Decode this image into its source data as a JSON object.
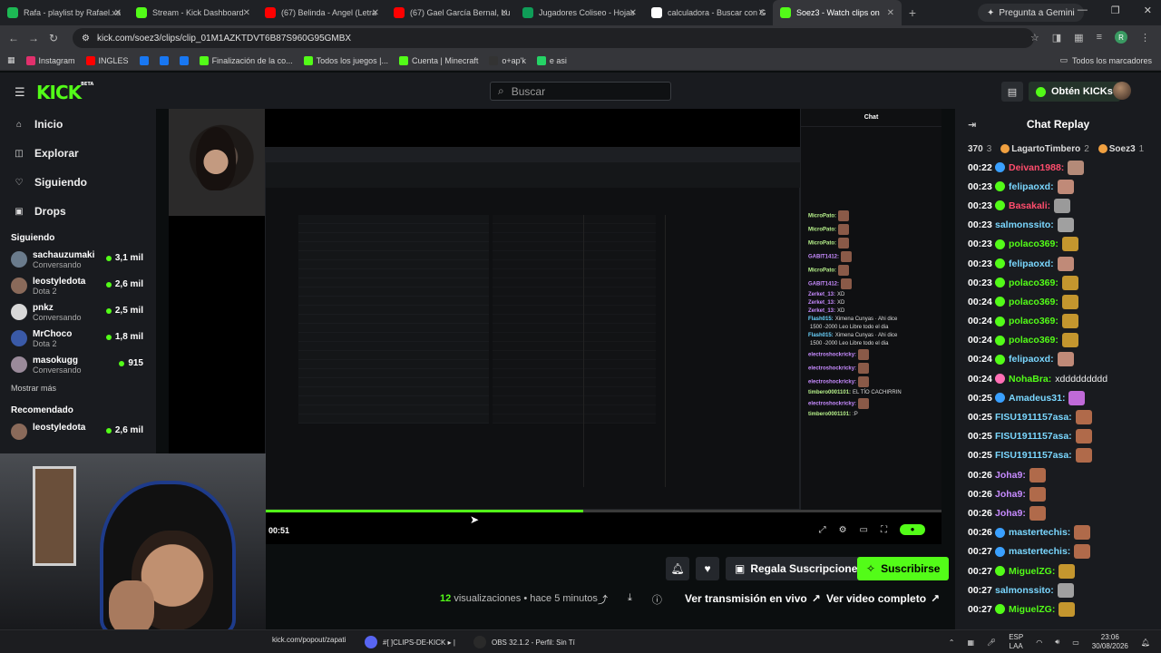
{
  "browser": {
    "tabs": [
      {
        "title": "Rafa - playlist by Rafael.xa",
        "color": "#1db954",
        "active": false
      },
      {
        "title": "Stream - Kick Dashboard",
        "color": "#53fc18",
        "active": false
      },
      {
        "title": "(67) Belinda - Angel (Letra",
        "color": "#ff0000",
        "active": false
      },
      {
        "title": "(67) Gael García Bernal, Lu",
        "color": "#ff0000",
        "active": false
      },
      {
        "title": "Jugadores Coliseo - Hojas",
        "color": "#0f9d58",
        "active": false
      },
      {
        "title": "calculadora - Buscar con G",
        "color": "#ffffff",
        "active": false
      },
      {
        "title": "Soez3 - Watch clips on",
        "color": "#53fc18",
        "active": true
      }
    ],
    "new_tab": "+",
    "gemini_label": "Pregunta a Gemini",
    "url": "kick.com/soez3/clips/clip_01M1AZKTDVT6B87S960G95GMBX",
    "bookmarks": [
      {
        "label": "Instagram",
        "color": "#e1306c"
      },
      {
        "label": "INGLES",
        "color": "#ff0000"
      },
      {
        "label": "",
        "color": "#1877f2"
      },
      {
        "label": "",
        "color": "#1877f2"
      },
      {
        "label": "",
        "color": "#1877f2"
      },
      {
        "label": "Finalización de la co...",
        "color": "#53fc18"
      },
      {
        "label": "Todos los juegos |...",
        "color": "#53fc18"
      },
      {
        "label": "Cuenta | Minecraft",
        "color": "#53fc18"
      },
      {
        "label": "o+ap'k",
        "color": "#333333"
      },
      {
        "label": "e asi",
        "color": "#25d366"
      }
    ],
    "all_bookmarks": "Todos los marcadores",
    "profile_initial": "R"
  },
  "header": {
    "logo": "KICK",
    "logo_badge": "BETA",
    "search_placeholder": "Buscar",
    "get_kicks": "Obtén KICKs"
  },
  "sidebar": {
    "nav": [
      {
        "label": "Inicio",
        "icon": "home-icon",
        "glyph": "⌂"
      },
      {
        "label": "Explorar",
        "icon": "compass-icon",
        "glyph": "◫"
      },
      {
        "label": "Siguiendo",
        "icon": "heart-icon",
        "glyph": "♡"
      },
      {
        "label": "Drops",
        "icon": "gift-icon",
        "glyph": "▣"
      }
    ],
    "following_title": "Siguiendo",
    "following": [
      {
        "name": "sachauzumaki",
        "category": "Conversando",
        "viewers": "3,1 mil",
        "color": "#6a7b8c"
      },
      {
        "name": "leostyledota",
        "category": "Dota 2",
        "viewers": "2,6 mil",
        "color": "#8a6a5a"
      },
      {
        "name": "pnkz",
        "category": "Conversando",
        "viewers": "2,5 mil",
        "color": "#d8d8d8"
      },
      {
        "name": "MrChoco",
        "category": "Dota 2",
        "viewers": "1,8 mil",
        "color": "#3a5aa8"
      },
      {
        "name": "masokugg",
        "category": "Conversando",
        "viewers": "915",
        "color": "#9a8a9a"
      }
    ],
    "show_more": "Mostrar más",
    "recommended_title": "Recomendado",
    "recommended": [
      {
        "name": "leostyledota",
        "category": "",
        "viewers": "2,6 mil",
        "color": "#8a6a5a"
      }
    ]
  },
  "player": {
    "time": "00:51",
    "progress": 0.47,
    "inner_chat_title": "Chat",
    "inner_chat": [
      {
        "user": "MicroPato:",
        "text": "",
        "cls": "g",
        "emote": true
      },
      {
        "user": "MicroPato:",
        "text": "",
        "cls": "g",
        "emote": true
      },
      {
        "user": "MicroPato:",
        "text": "",
        "cls": "g",
        "emote": true
      },
      {
        "user": "GABIT1412:",
        "text": "",
        "cls": "p",
        "emote": true
      },
      {
        "user": "MicroPato:",
        "text": "",
        "cls": "g",
        "emote": true
      },
      {
        "user": "GABIT1412:",
        "text": "",
        "cls": "p",
        "emote": true
      },
      {
        "user": "Zerket_13:",
        "text": "XD",
        "cls": "p",
        "emote": false
      },
      {
        "user": "Zerket_13:",
        "text": "XD",
        "cls": "p",
        "emote": false
      },
      {
        "user": "Zerket_13:",
        "text": "XD",
        "cls": "p",
        "emote": false
      },
      {
        "user": "Flash015:",
        "text": "Ximena Cunyas · Ahi dice",
        "cls": "",
        "emote": false
      },
      {
        "user": "",
        "text": "1500 -2000 Leo Libre todo el dia",
        "cls": "",
        "emote": false
      },
      {
        "user": "Flash015:",
        "text": "Ximena Cunyas · Ahi dice",
        "cls": "",
        "emote": false
      },
      {
        "user": "",
        "text": "1500 -2000 Leo Libre todo el dia",
        "cls": "",
        "emote": false
      },
      {
        "user": "electroshockricky:",
        "text": "",
        "cls": "p",
        "emote": true
      },
      {
        "user": "electroshockricky:",
        "text": "",
        "cls": "p",
        "emote": true
      },
      {
        "user": "electroshockricky:",
        "text": "",
        "cls": "p",
        "emote": true
      },
      {
        "user": "timbero0001101:",
        "text": "EL TÍO CACHIRRIN",
        "cls": "g",
        "emote": false
      },
      {
        "user": "electroshockricky:",
        "text": "",
        "cls": "p",
        "emote": true
      },
      {
        "user": "timbero0001101:",
        "text": ":P",
        "cls": "g",
        "emote": false
      }
    ]
  },
  "actions": {
    "gift_label": "Regala Suscripciones",
    "subscribe_label": "Suscribirse",
    "views_count": "12",
    "views_label": "visualizaciones",
    "ago": "hace 5 minutos",
    "watch_live": "Ver transmisión en vivo",
    "watch_full": "Ver video completo"
  },
  "chat": {
    "title": "Chat Replay",
    "leaderboard": [
      {
        "name": "370",
        "count": "3"
      },
      {
        "name": "LagartoTimbero",
        "count": "2"
      },
      {
        "name": "Soez3",
        "count": "1"
      }
    ],
    "messages": [
      {
        "ts": "00:22",
        "user": "Deivan1988:",
        "text": "",
        "color": "#ff4d6d",
        "badge": "#3aa0ff",
        "emote": "#b48a78"
      },
      {
        "ts": "00:23",
        "user": "felipaoxd:",
        "text": "",
        "color": "#7ad7ff",
        "badge": "#53fc18",
        "emote": "#c08a78"
      },
      {
        "ts": "00:23",
        "user": "Basakali:",
        "text": "",
        "color": "#ff4d6d",
        "badge": "#53fc18",
        "emote": "#9a9a9a"
      },
      {
        "ts": "00:23",
        "user": "salmonssito:",
        "text": "",
        "color": "#7ad7ff",
        "badge": "",
        "emote": "#a0a0a0"
      },
      {
        "ts": "00:23",
        "user": "polaco369:",
        "text": "",
        "color": "#53fc18",
        "badge": "#53fc18",
        "emote": "#c4962e"
      },
      {
        "ts": "00:23",
        "user": "felipaoxd:",
        "text": "",
        "color": "#7ad7ff",
        "badge": "#53fc18",
        "emote": "#c08a78"
      },
      {
        "ts": "00:23",
        "user": "polaco369:",
        "text": "",
        "color": "#53fc18",
        "badge": "#53fc18",
        "emote": "#c4962e"
      },
      {
        "ts": "00:24",
        "user": "polaco369:",
        "text": "",
        "color": "#53fc18",
        "badge": "#53fc18",
        "emote": "#c4962e"
      },
      {
        "ts": "00:24",
        "user": "polaco369:",
        "text": "",
        "color": "#53fc18",
        "badge": "#53fc18",
        "emote": "#c4962e"
      },
      {
        "ts": "00:24",
        "user": "polaco369:",
        "text": "",
        "color": "#53fc18",
        "badge": "#53fc18",
        "emote": "#c4962e"
      },
      {
        "ts": "00:24",
        "user": "felipaoxd:",
        "text": "",
        "color": "#7ad7ff",
        "badge": "#53fc18",
        "emote": "#c08a78"
      },
      {
        "ts": "00:24",
        "user": "NohaBra:",
        "text": "xddddddddd",
        "color": "#53fc18",
        "badge": "#ff6fb5",
        "emote": ""
      },
      {
        "ts": "00:25",
        "user": "Amadeus31:",
        "text": "",
        "color": "#7ad7ff",
        "badge": "#3aa0ff",
        "emote": "#c06ad8"
      },
      {
        "ts": "00:25",
        "user": "FISU1911157asa:",
        "text": "",
        "color": "#7ad7ff",
        "badge": "",
        "emote": "#b06a4a"
      },
      {
        "ts": "00:25",
        "user": "FISU1911157asa:",
        "text": "",
        "color": "#7ad7ff",
        "badge": "",
        "emote": "#b06a4a"
      },
      {
        "ts": "00:25",
        "user": "FISU1911157asa:",
        "text": "",
        "color": "#7ad7ff",
        "badge": "",
        "emote": "#b06a4a"
      },
      {
        "ts": "00:26",
        "user": "Joha9:",
        "text": "",
        "color": "#c78bff",
        "badge": "",
        "emote": "#b06a4a"
      },
      {
        "ts": "00:26",
        "user": "Joha9:",
        "text": "",
        "color": "#c78bff",
        "badge": "",
        "emote": "#b06a4a"
      },
      {
        "ts": "00:26",
        "user": "Joha9:",
        "text": "",
        "color": "#c78bff",
        "badge": "",
        "emote": "#b06a4a"
      },
      {
        "ts": "00:26",
        "user": "mastertechis:",
        "text": "",
        "color": "#7ad7ff",
        "badge": "#3aa0ff",
        "emote": "#b06a4a"
      },
      {
        "ts": "00:27",
        "user": "mastertechis:",
        "text": "",
        "color": "#7ad7ff",
        "badge": "#3aa0ff",
        "emote": "#b06a4a"
      },
      {
        "ts": "00:27",
        "user": "MiguelZG:",
        "text": "",
        "color": "#53fc18",
        "badge": "#53fc18",
        "emote": "#c4962e"
      },
      {
        "ts": "00:27",
        "user": "salmonssito:",
        "text": "",
        "color": "#7ad7ff",
        "badge": "",
        "emote": "#a0a0a0"
      },
      {
        "ts": "00:27",
        "user": "MiguelZG:",
        "text": "",
        "color": "#53fc18",
        "badge": "#53fc18",
        "emote": "#c4962e"
      }
    ]
  },
  "taskbar": {
    "items": [
      {
        "label": "kick.com/popout/zapati",
        "color": "#333333"
      },
      {
        "label": "#[ ]CLIPS-DE-KICK ▸ |",
        "color": "#5865f2"
      },
      {
        "label": "OBS 32.1.2 - Perfil: Sin Tí",
        "color": "#2a2a2a"
      }
    ],
    "lang": "ESP",
    "layout": "LAA",
    "time": "23:06",
    "date": "30/08/2026"
  }
}
